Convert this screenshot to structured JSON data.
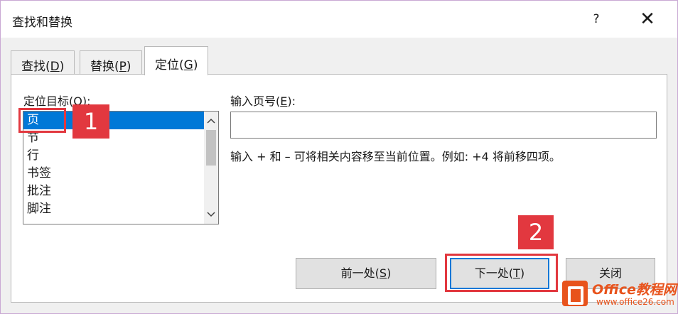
{
  "dialog": {
    "title": "查找和替换",
    "help_label": "?",
    "close_label": "✕"
  },
  "tabs": [
    {
      "label_main": "查找(",
      "label_key": "D",
      "label_end": ")"
    },
    {
      "label_main": "替换(",
      "label_key": "P",
      "label_end": ")"
    },
    {
      "label_main": "定位(",
      "label_key": "G",
      "label_end": ")"
    }
  ],
  "goto": {
    "target_label": "定位目标(O):",
    "targets": [
      "页",
      "节",
      "行",
      "书签",
      "批注",
      "脚注"
    ],
    "selected_target": "页",
    "page_label_main": "输入页号(",
    "page_label_key": "E",
    "page_label_end": "):",
    "page_value": "",
    "hint": "输入 + 和 – 可将相关内容移至当前位置。例如: +4 将前移四项。"
  },
  "buttons": {
    "prev_main": "前一处(",
    "prev_key": "S",
    "prev_end": ")",
    "next_main": "下一处(",
    "next_key": "T",
    "next_end": ")",
    "close": "关闭"
  },
  "callouts": {
    "step1": "1",
    "step2": "2"
  },
  "watermark": {
    "title": "Office教程网",
    "url": "www.office26.com"
  },
  "colors": {
    "accent": "#0078d7",
    "callout": "#e2383f",
    "watermark": "#e8531c"
  }
}
